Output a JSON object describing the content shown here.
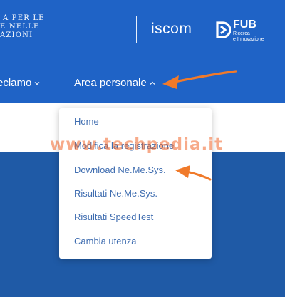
{
  "header": {
    "agency_lines": [
      "A PER LE",
      "E NELLE",
      "AZIONI"
    ],
    "iscom_label": "iscom",
    "fub_label": "FUB",
    "fub_subtitle_line1": "Ricerca",
    "fub_subtitle_line2": "e Innovazione"
  },
  "nav": {
    "reclamo_label": "eclamo",
    "area_label": "Area personale"
  },
  "dropdown": {
    "items": [
      "Home",
      "Modifica la registrazione",
      "Download Ne.Me.Sys.",
      "Risultati Ne.Me.Sys.",
      "Risultati SpeedTest",
      "Cambia utenza"
    ]
  },
  "watermark": {
    "text": "www.techpedia.it"
  },
  "colors": {
    "header_blue": "#1f63c6",
    "body_blue": "#1f5aa6",
    "menu_text": "#3f6db0",
    "arrow_orange": "#f07a2a"
  }
}
